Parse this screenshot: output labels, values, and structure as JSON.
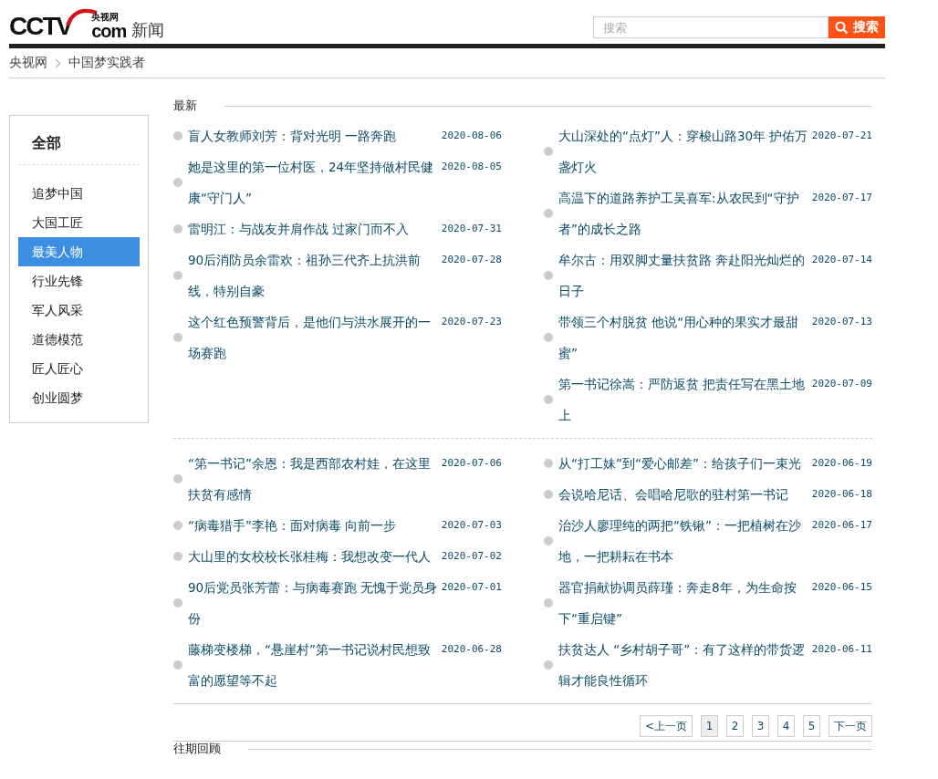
{
  "header": {
    "logo": {
      "mark": "CCTV",
      "com": "com",
      "site": "央视网"
    },
    "channel": "新闻",
    "search": {
      "placeholder": "搜索",
      "button": "搜索"
    }
  },
  "breadcrumb": [
    "央视网",
    "中国梦实践者"
  ],
  "sidebar": {
    "title": "全部",
    "items": [
      {
        "label": "追梦中国",
        "selected": false
      },
      {
        "label": "大国工匠",
        "selected": false
      },
      {
        "label": "最美人物",
        "selected": true
      },
      {
        "label": "行业先锋",
        "selected": false
      },
      {
        "label": "军人风采",
        "selected": false
      },
      {
        "label": "道德模范",
        "selected": false
      },
      {
        "label": "匠人匠心",
        "selected": false
      },
      {
        "label": "创业圆梦",
        "selected": false
      }
    ]
  },
  "latest": {
    "title": "最新",
    "blocks": [
      {
        "columns": [
          [
            {
              "title": "盲人女教师刘芳：背对光明 一路奔跑",
              "date": "2020-08-06"
            },
            {
              "title": "她是这里的第一位村医，24年坚持做村民健康“守门人”",
              "date": "2020-08-05"
            },
            {
              "title": "雷明江：与战友并肩作战 过家门而不入",
              "date": "2020-07-31"
            },
            {
              "title": "90后消防员余雷欢：祖孙三代齐上抗洪前线，特别自豪",
              "date": "2020-07-28"
            },
            {
              "title": "这个红色预警背后，是他们与洪水展开的一场赛跑",
              "date": "2020-07-23"
            }
          ],
          [
            {
              "title": "大山深处的“点灯”人：穿梭山路30年 护佑万盏灯火",
              "date": "2020-07-21"
            },
            {
              "title": "高温下的道路养护工吴喜军:从农民到“守护者”的成长之路",
              "date": "2020-07-17"
            },
            {
              "title": "牟尔古：用双脚丈量扶贫路 奔赴阳光灿烂的日子",
              "date": "2020-07-14"
            },
            {
              "title": "带领三个村脱贫 他说“用心种的果实才最甜蜜”",
              "date": "2020-07-13"
            },
            {
              "title": "第一书记徐嵩：严防返贫 把责任写在黑土地上",
              "date": "2020-07-09"
            }
          ]
        ]
      },
      {
        "columns": [
          [
            {
              "title": "“第一书记”余恩：我是西部农村娃，在这里扶贫有感情",
              "date": "2020-07-06"
            },
            {
              "title": "“病毒猎手”李艳：面对病毒 向前一步",
              "date": "2020-07-03"
            },
            {
              "title": "大山里的女校校长张桂梅：我想改变一代人",
              "date": "2020-07-02"
            },
            {
              "title": "90后党员张芳蕾：与病毒赛跑 无愧于党员身份",
              "date": "2020-07-01"
            },
            {
              "title": "藤梯变楼梯，“悬崖村”第一书记说村民想致富的愿望等不起",
              "date": "2020-06-28"
            }
          ],
          [
            {
              "title": "从“打工妹”到“爱心邮差”：给孩子们一束光",
              "date": "2020-06-19"
            },
            {
              "title": "会说哈尼话、会唱哈尼歌的驻村第一书记",
              "date": "2020-06-18"
            },
            {
              "title": "治沙人廖理纯的两把“铁锹”：一把植树在沙地，一把耕耘在书本",
              "date": "2020-06-17"
            },
            {
              "title": "器官捐献协调员薛瑾：奔走8年，为生命按下“重启键”",
              "date": "2020-06-15"
            },
            {
              "title": "扶贫达人 “乡村胡子哥”：有了这样的带货逻辑才能良性循环",
              "date": "2020-06-11"
            }
          ]
        ]
      }
    ]
  },
  "pagination": {
    "prev": "<上一页",
    "pages": [
      {
        "label": "1",
        "selected": true
      },
      {
        "label": "2",
        "selected": false
      },
      {
        "label": "3",
        "selected": false
      },
      {
        "label": "4",
        "selected": false
      },
      {
        "label": "5",
        "selected": false
      }
    ],
    "next": "下一页"
  },
  "archive": {
    "title": "往期回顾"
  }
}
